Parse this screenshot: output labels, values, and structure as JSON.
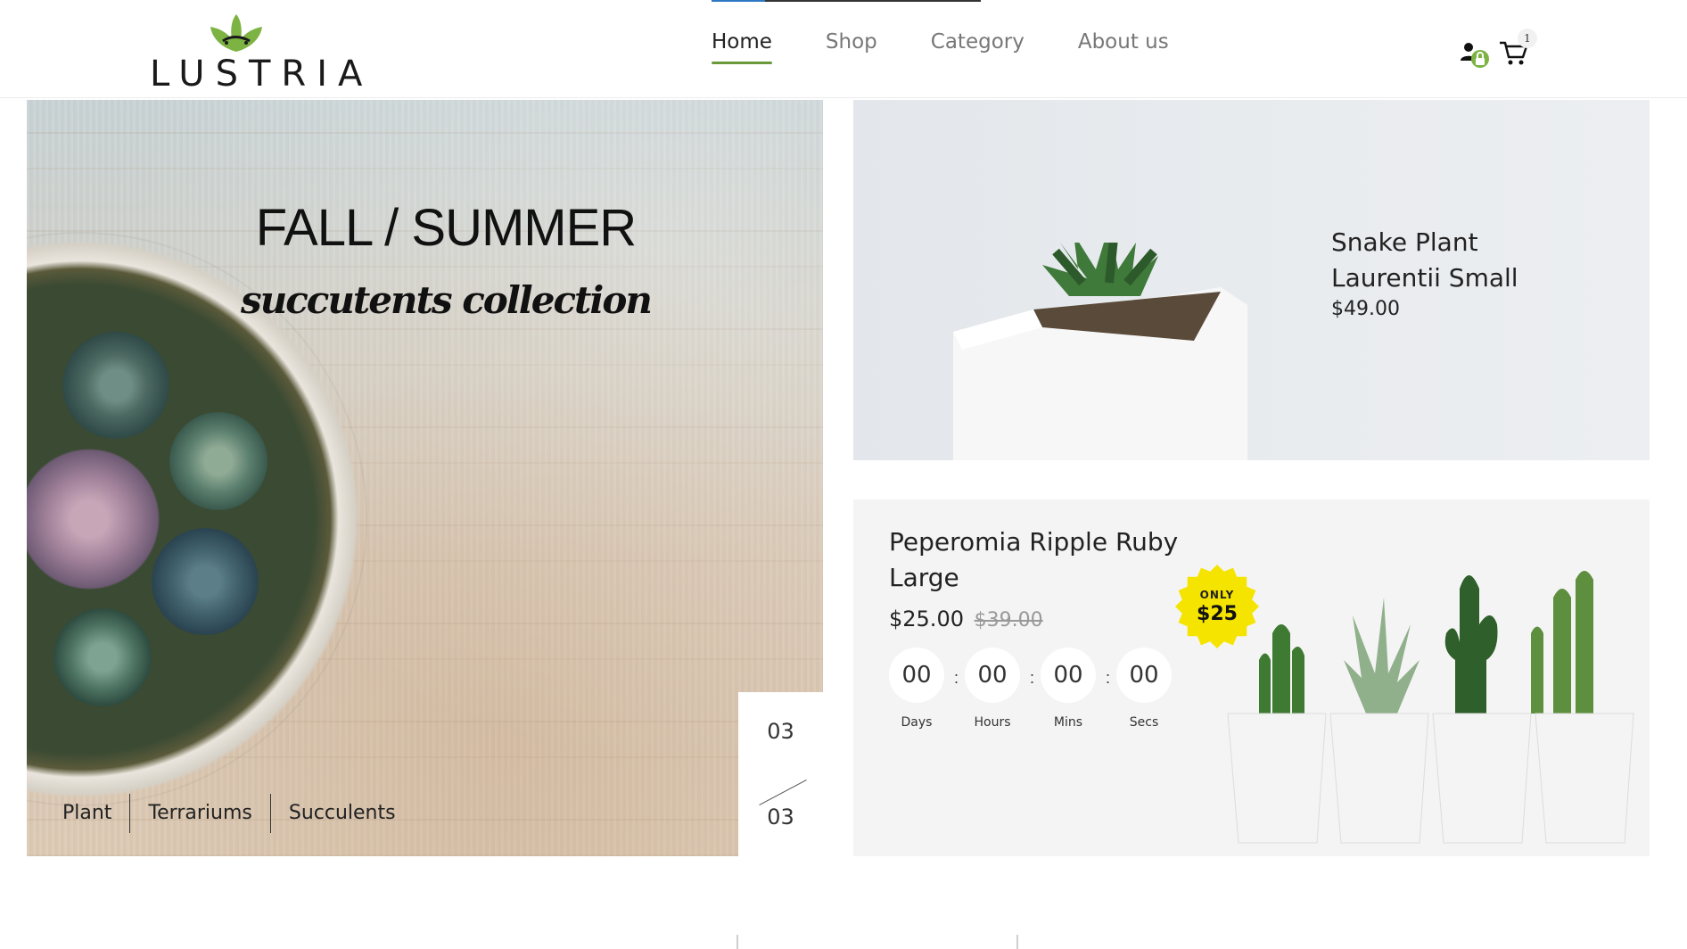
{
  "header": {
    "logo_text": "LUSTRIA",
    "nav": [
      {
        "label": "Home",
        "active": true
      },
      {
        "label": "Shop",
        "active": false
      },
      {
        "label": "Category",
        "active": false
      },
      {
        "label": "About us",
        "active": false
      }
    ],
    "cart_count": "1",
    "accent_color": "#6a9a3c",
    "icons": [
      "user-lock-icon",
      "cart-icon"
    ]
  },
  "hero": {
    "title": "FALL / SUMMER",
    "subtitle": "succutents collection",
    "categories": [
      "Plant",
      "Terrariums",
      "Succulents"
    ],
    "slide_current": "03",
    "slide_total": "03"
  },
  "featured": {
    "name": "Snake Plant Laurentii Small",
    "price": "$49.00"
  },
  "deal": {
    "name": "Peperomia Ripple Ruby Large",
    "price": "$25.00",
    "old_price": "$39.00",
    "badge_top": "ONLY",
    "badge_price": "$25",
    "badge_color": "#f5e400",
    "countdown": [
      {
        "value": "00",
        "label": "Days"
      },
      {
        "value": "00",
        "label": "Hours"
      },
      {
        "value": "00",
        "label": "Mins"
      },
      {
        "value": "00",
        "label": "Secs"
      }
    ]
  }
}
